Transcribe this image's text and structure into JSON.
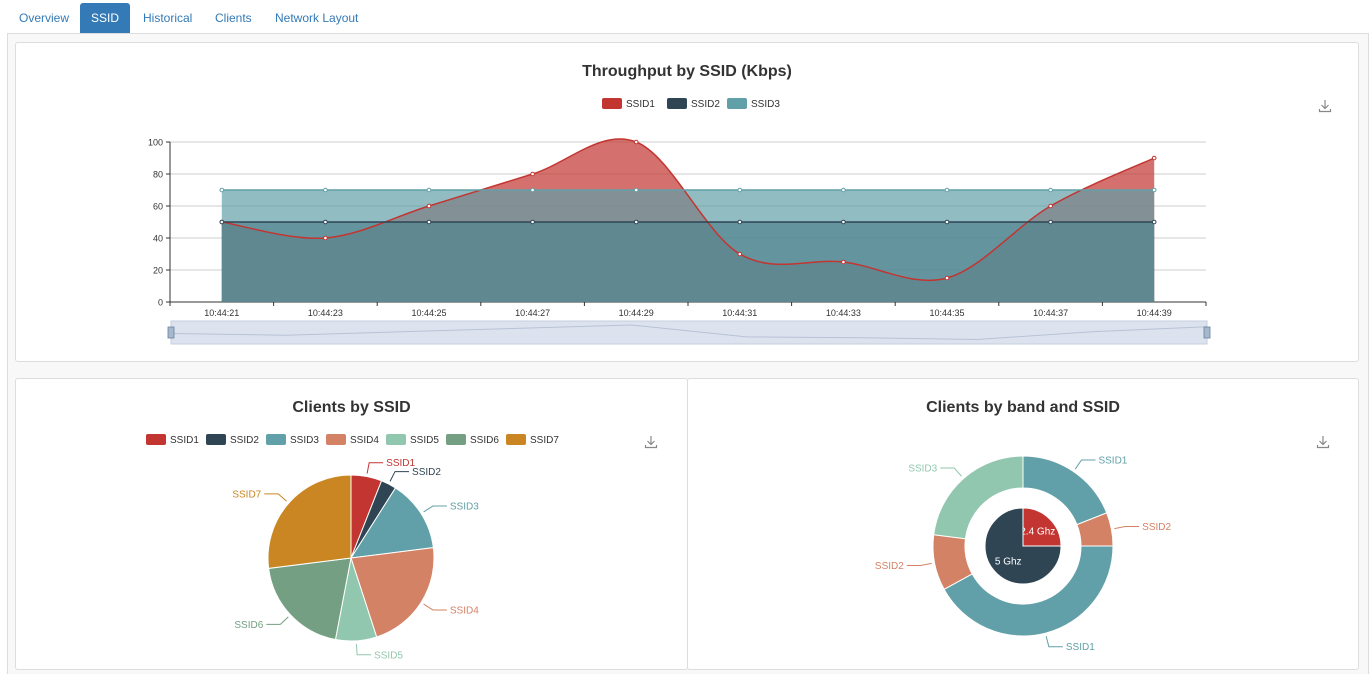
{
  "tabs": [
    {
      "label": "Overview"
    },
    {
      "label": "SSID",
      "active": true
    },
    {
      "label": "Historical"
    },
    {
      "label": "Clients"
    },
    {
      "label": "Network Layout"
    }
  ],
  "throughput": {
    "title": "Throughput by SSID (Kbps)",
    "chart_data": {
      "type": "area",
      "title": "Throughput by SSID (Kbps)",
      "x": [
        "10:44:21",
        "10:44:23",
        "10:44:25",
        "10:44:27",
        "10:44:29",
        "10:44:31",
        "10:44:33",
        "10:44:35",
        "10:44:37",
        "10:44:39"
      ],
      "ylim": [
        0,
        100
      ],
      "yticks": [
        0,
        20,
        40,
        60,
        80,
        100
      ],
      "grid": true,
      "legend": "top",
      "series": [
        {
          "name": "SSID1",
          "color": "#c23531",
          "values": [
            50,
            40,
            60,
            80,
            100,
            30,
            25,
            15,
            60,
            90
          ]
        },
        {
          "name": "SSID2",
          "color": "#2f4554",
          "values": [
            50,
            50,
            50,
            50,
            50,
            50,
            50,
            50,
            50,
            50
          ]
        },
        {
          "name": "SSID3",
          "color": "#61a0a8",
          "values": [
            70,
            70,
            70,
            70,
            70,
            70,
            70,
            70,
            70,
            70
          ]
        }
      ]
    }
  },
  "clients_ssid": {
    "title": "Clients by SSID",
    "chart_data": {
      "type": "pie",
      "title": "Clients by SSID",
      "legend": "top",
      "slices": [
        {
          "name": "SSID1",
          "value": 6,
          "color": "#c23531"
        },
        {
          "name": "SSID2",
          "value": 3,
          "color": "#2f4554"
        },
        {
          "name": "SSID3",
          "value": 14,
          "color": "#61a0a8"
        },
        {
          "name": "SSID4",
          "value": 22,
          "color": "#d48265"
        },
        {
          "name": "SSID5",
          "value": 8,
          "color": "#91c7ae"
        },
        {
          "name": "SSID6",
          "value": 20,
          "color": "#749f83"
        },
        {
          "name": "SSID7",
          "value": 27,
          "color": "#ca8622"
        }
      ]
    }
  },
  "clients_band": {
    "title": "Clients by band and SSID",
    "chart_data": {
      "type": "pie",
      "title": "Clients by band and SSID",
      "inner": [
        {
          "name": "2.4 Ghz",
          "value": 25,
          "color": "#c23531"
        },
        {
          "name": "5 Ghz",
          "value": 75,
          "color": "#2f4554"
        }
      ],
      "outer": [
        {
          "name": "SSID1",
          "value": 19,
          "color": "#61a0a8"
        },
        {
          "name": "SSID2",
          "value": 6,
          "color": "#d48265"
        },
        {
          "name": "SSID1",
          "value": 42,
          "color": "#61a0a8"
        },
        {
          "name": "SSID2",
          "value": 10,
          "color": "#d48265"
        },
        {
          "name": "SSID3",
          "value": 23,
          "color": "#91c7ae"
        }
      ]
    }
  }
}
